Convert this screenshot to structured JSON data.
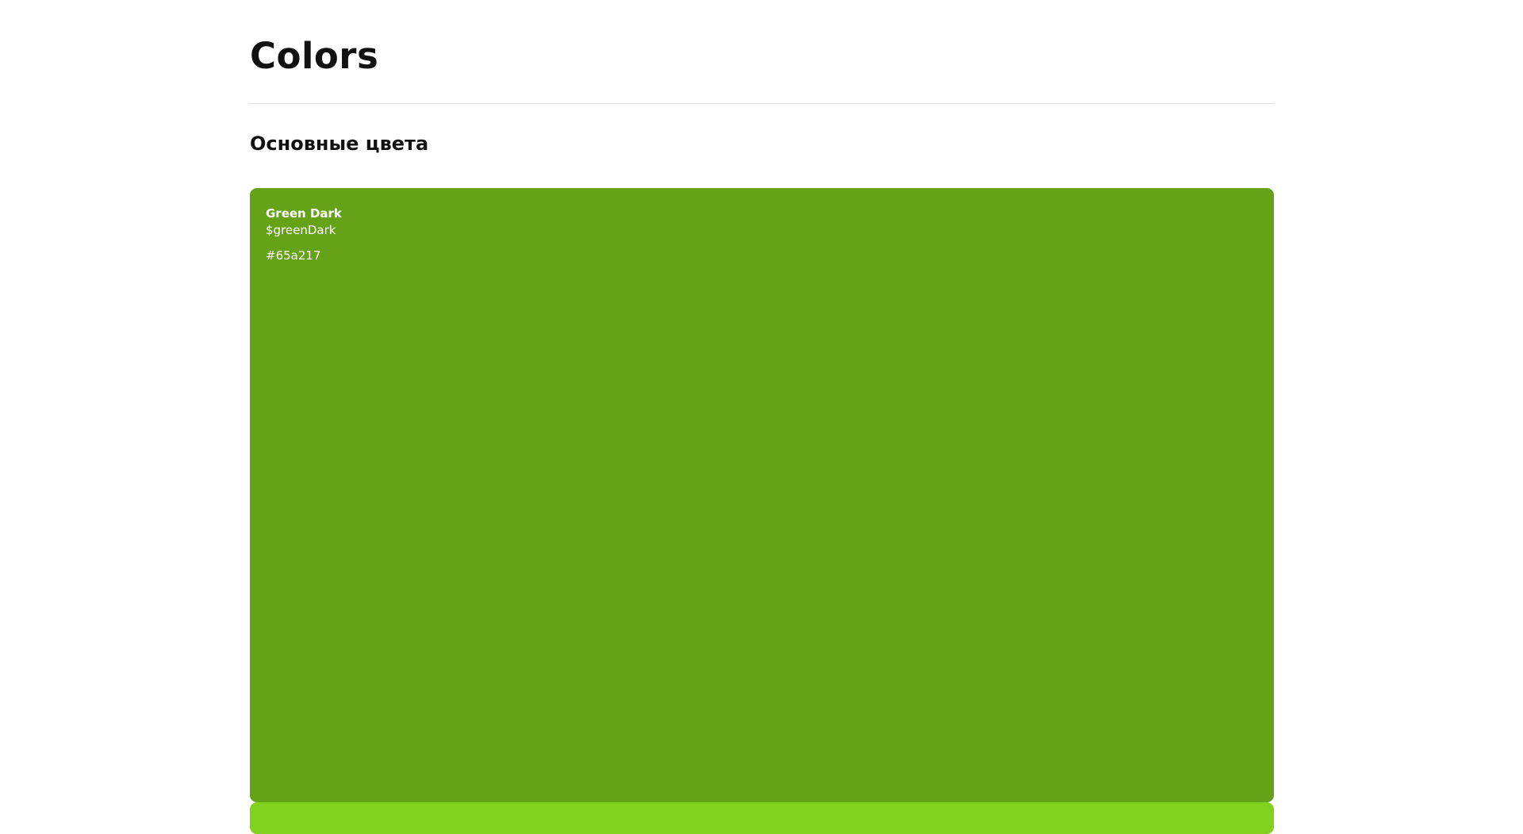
{
  "page": {
    "title": "Colors"
  },
  "section": {
    "title": "Основные цвета"
  },
  "swatches": [
    {
      "name": "Green Dark",
      "variable": "$greenDark",
      "hex": "#65a217",
      "color": "#65a217"
    },
    {
      "color": "#82d11f"
    }
  ]
}
